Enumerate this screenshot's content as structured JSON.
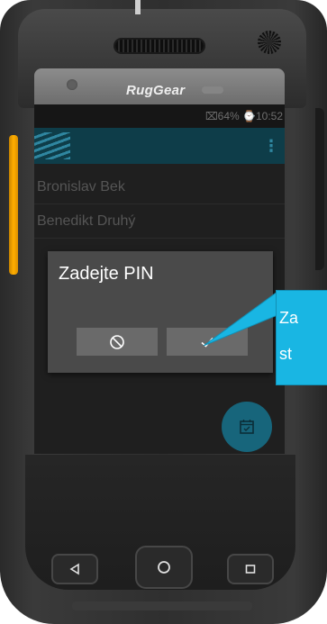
{
  "device": {
    "brand": "RugGear"
  },
  "status_bar": {
    "text": "⌧64% ⌚10:52"
  },
  "app_bar": {
    "menu_glyph": "⋮"
  },
  "contacts": [
    "Bronislav Bek",
    "Benedikt Druhý"
  ],
  "dialog": {
    "title": "Zadejte PIN",
    "cancel_icon": "cancel-icon",
    "confirm_icon": "check-icon"
  },
  "callout": {
    "line1": "Za",
    "line2": "st"
  },
  "nav_keys": [
    "back-icon",
    "home-icon",
    "recents-icon"
  ],
  "colors": {
    "accent": "#0e3d49",
    "fab": "#17657b",
    "callout": "#19b6e3"
  }
}
